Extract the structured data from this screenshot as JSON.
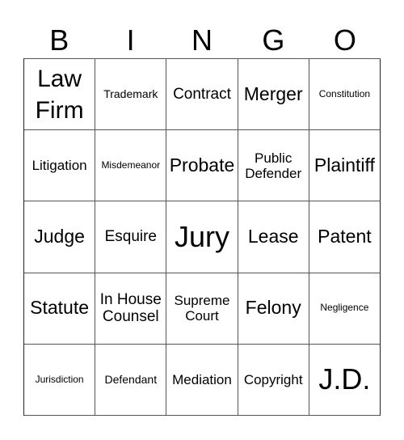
{
  "header": [
    "B",
    "I",
    "N",
    "G",
    "O"
  ],
  "cells": [
    {
      "text": "Law Firm",
      "size": "xxl"
    },
    {
      "text": "Trademark",
      "size": "sm"
    },
    {
      "text": "Contract",
      "size": "lg"
    },
    {
      "text": "Merger",
      "size": "xl"
    },
    {
      "text": "Constitution",
      "size": "xs"
    },
    {
      "text": "Litigation",
      "size": "md"
    },
    {
      "text": "Misdemeanor",
      "size": "xs"
    },
    {
      "text": "Probate",
      "size": "xl"
    },
    {
      "text": "Public Defender",
      "size": "md"
    },
    {
      "text": "Plaintiff",
      "size": "xl"
    },
    {
      "text": "Judge",
      "size": "xl"
    },
    {
      "text": "Esquire",
      "size": "lg"
    },
    {
      "text": "Jury",
      "size": "huge"
    },
    {
      "text": "Lease",
      "size": "xl"
    },
    {
      "text": "Patent",
      "size": "xl"
    },
    {
      "text": "Statute",
      "size": "xl"
    },
    {
      "text": "In House Counsel",
      "size": "lg"
    },
    {
      "text": "Supreme Court",
      "size": "md"
    },
    {
      "text": "Felony",
      "size": "xl"
    },
    {
      "text": "Negligence",
      "size": "xs"
    },
    {
      "text": "Jurisdiction",
      "size": "xs"
    },
    {
      "text": "Defendant",
      "size": "sm"
    },
    {
      "text": "Mediation",
      "size": "md"
    },
    {
      "text": "Copyright",
      "size": "md"
    },
    {
      "text": "J.D.",
      "size": "huge"
    }
  ]
}
